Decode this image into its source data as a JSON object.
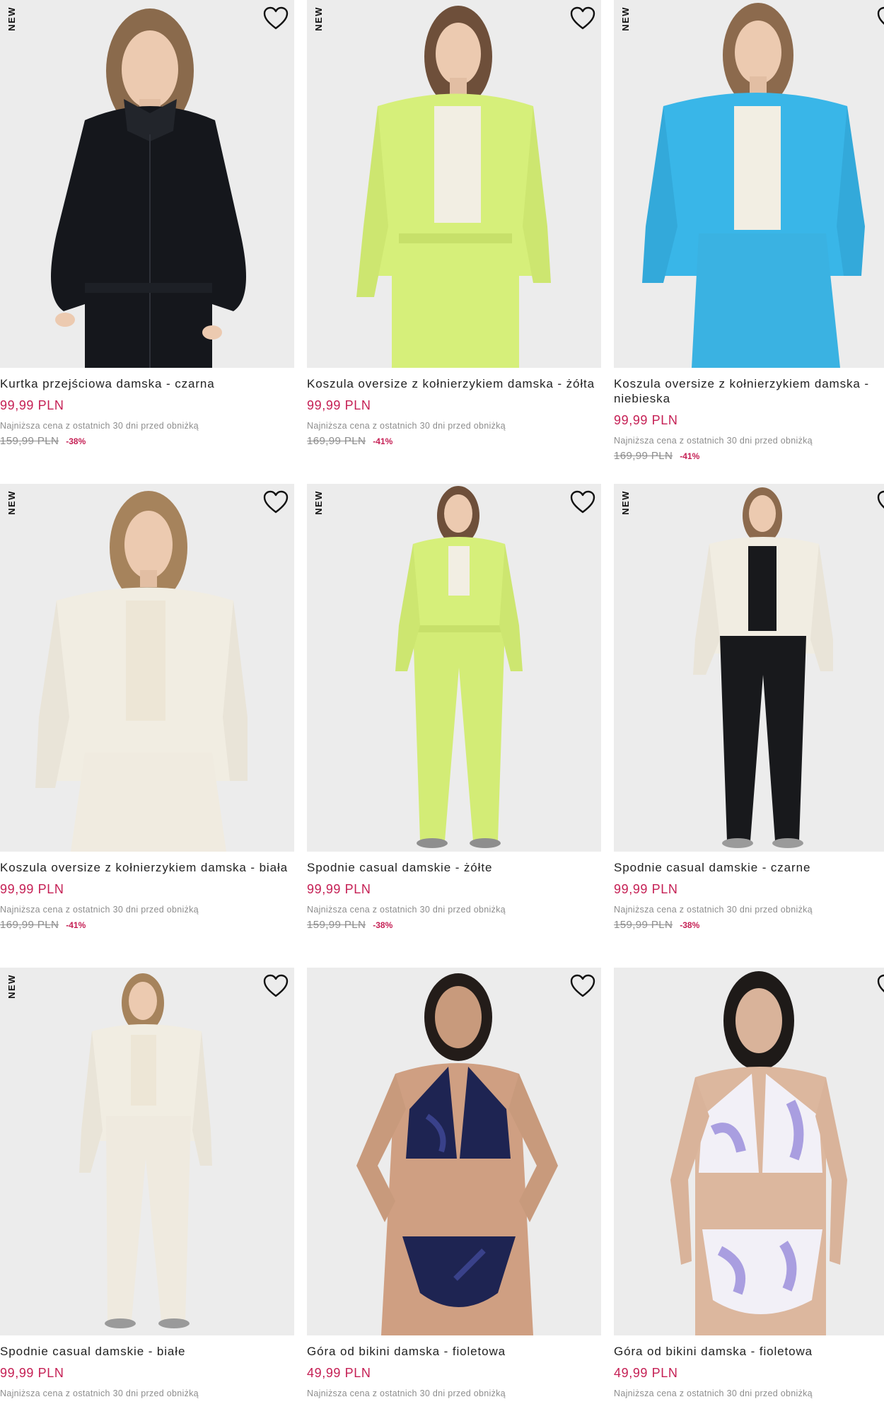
{
  "badge_label": "NEW",
  "colors": {
    "price_accent": "#c51f54",
    "muted_text": "#8d8d8d",
    "photo_background": "#ececec"
  },
  "products": [
    {
      "title": "Kurtka przejściowa damska - czarna",
      "price": "99,99 PLN",
      "lowest_note": "Najniższa cena z ostatnich 30 dni przed obniżką",
      "old_price": "159,99 PLN",
      "discount": "-38%",
      "is_new": true,
      "garment_color": "#15171c"
    },
    {
      "title": "Koszula oversize z kołnierzykiem damska - żółta",
      "price": "99,99 PLN",
      "lowest_note": "Najniższa cena z ostatnich 30 dni przed obniżką",
      "old_price": "169,99 PLN",
      "discount": "-41%",
      "is_new": true,
      "garment_color": "#d6ef7a"
    },
    {
      "title": "Koszula oversize z kołnierzykiem damska - niebieska",
      "price": "99,99 PLN",
      "lowest_note": "Najniższa cena z ostatnich 30 dni przed obniżką",
      "old_price": "169,99 PLN",
      "discount": "-41%",
      "is_new": true,
      "garment_color": "#39b6e8"
    },
    {
      "title": "Koszula oversize z kołnierzykiem damska - biała",
      "price": "99,99 PLN",
      "lowest_note": "Najniższa cena z ostatnich 30 dni przed obniżką",
      "old_price": "169,99 PLN",
      "discount": "-41%",
      "is_new": true,
      "garment_color": "#f1ede2"
    },
    {
      "title": "Spodnie casual damskie - żółte",
      "price": "99,99 PLN",
      "lowest_note": "Najniższa cena z ostatnich 30 dni przed obniżką",
      "old_price": "159,99 PLN",
      "discount": "-38%",
      "is_new": true,
      "garment_color": "#d6ef7a"
    },
    {
      "title": "Spodnie casual damskie - czarne",
      "price": "99,99 PLN",
      "lowest_note": "Najniższa cena z ostatnich 30 dni przed obniżką",
      "old_price": "159,99 PLN",
      "discount": "-38%",
      "is_new": true,
      "garment_color": "#18191c"
    },
    {
      "title": "Spodnie casual damskie - białe",
      "price": "99,99 PLN",
      "lowest_note": "Najniższa cena z ostatnich 30 dni przed obniżką",
      "is_new": true,
      "garment_color": "#efeadf"
    },
    {
      "title": "Góra od bikini damska - fioletowa",
      "price": "49,99 PLN",
      "lowest_note": "Najniższa cena z ostatnich 30 dni przed obniżką",
      "is_new": false,
      "garment_color": "#1e2452"
    },
    {
      "title": "Góra od bikini damska - fioletowa",
      "price": "49,99 PLN",
      "lowest_note": "Najniższa cena z ostatnich 30 dni przed obniżką",
      "is_new": false,
      "garment_color": "#a99ee0"
    }
  ]
}
